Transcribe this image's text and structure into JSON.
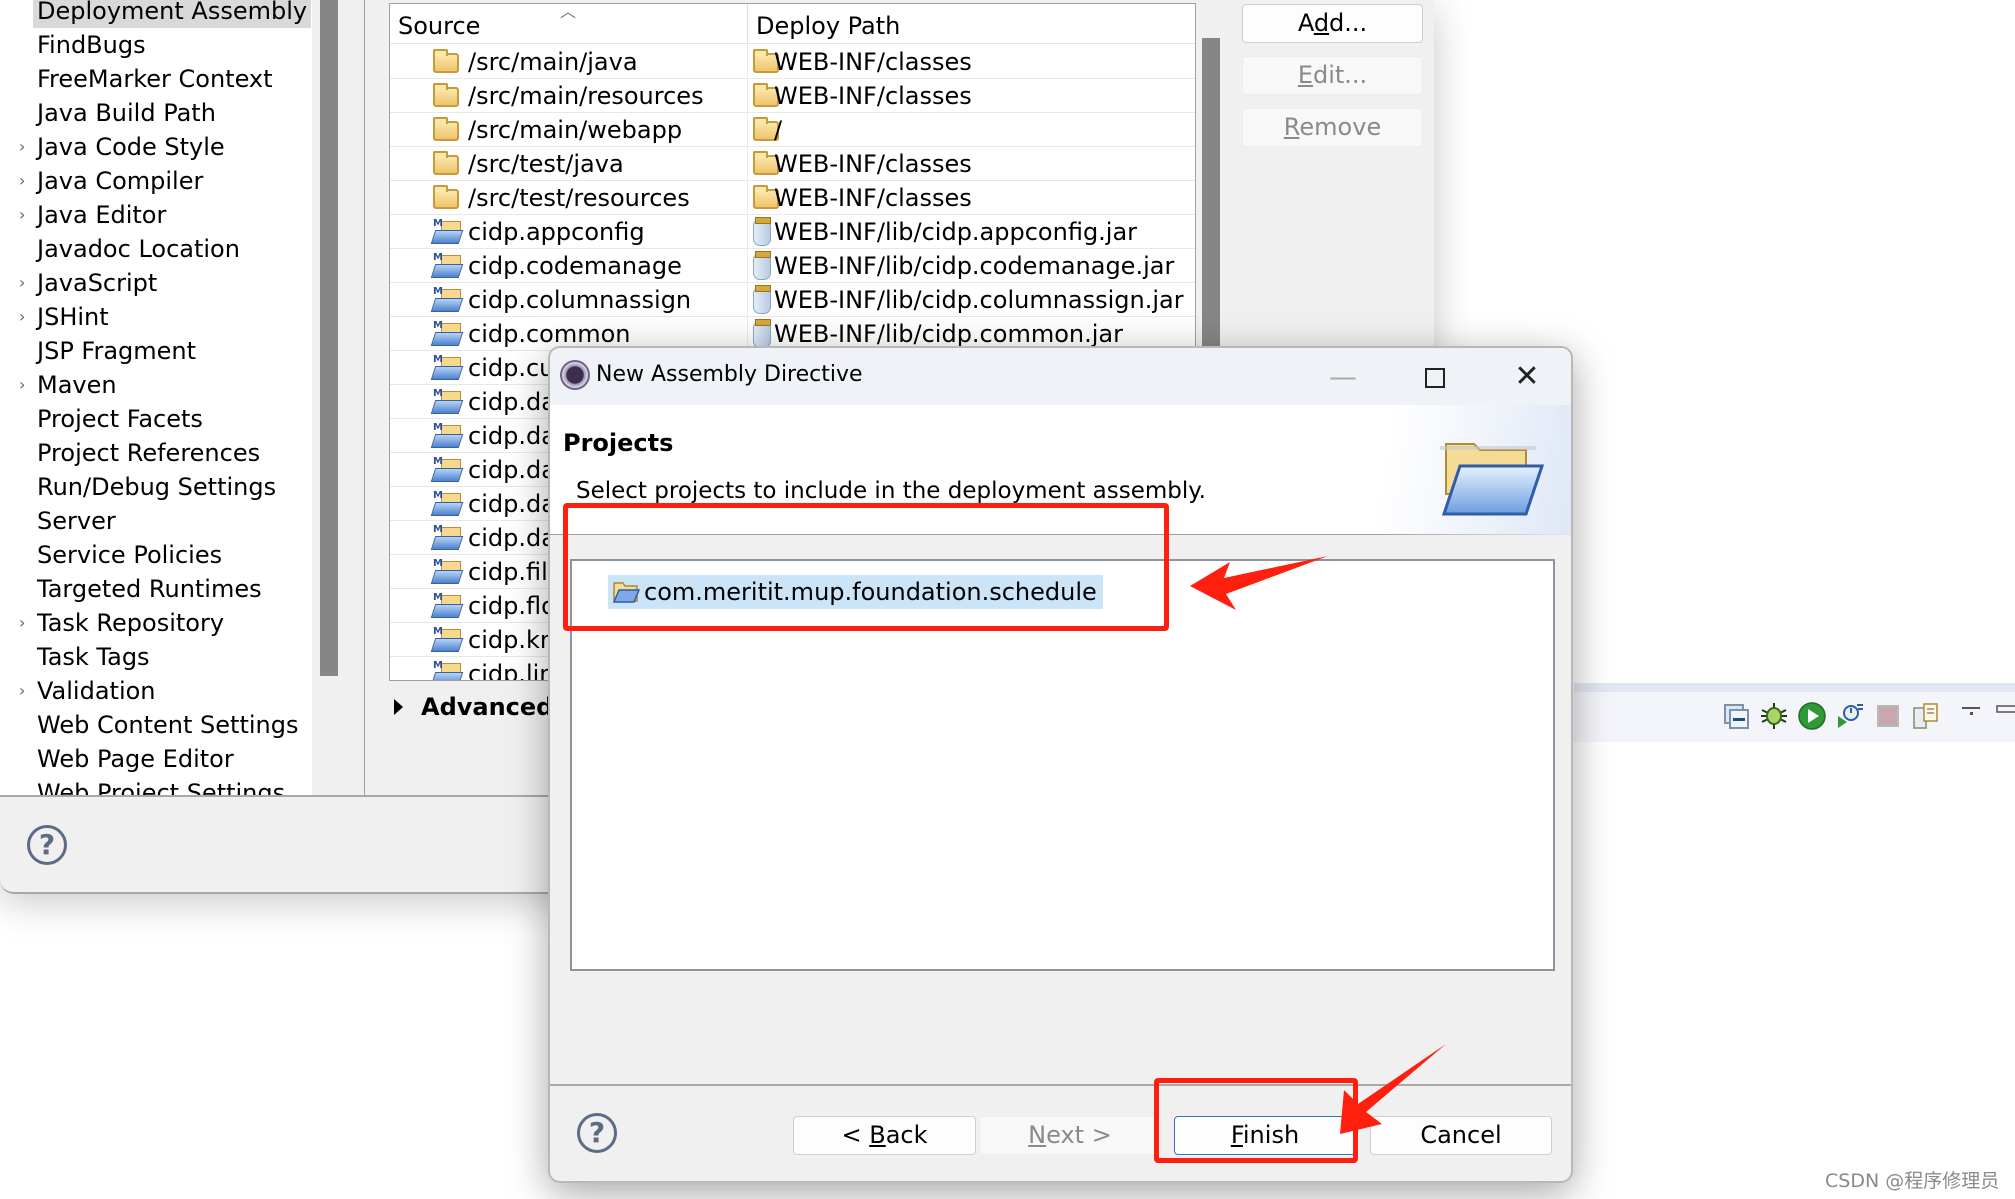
{
  "properties_dialog": {
    "sidebar": {
      "items": [
        {
          "label": "Deployment Assembly",
          "expandable": false,
          "selected": true
        },
        {
          "label": "FindBugs",
          "expandable": false
        },
        {
          "label": "FreeMarker Context",
          "expandable": false
        },
        {
          "label": "Java Build Path",
          "expandable": false
        },
        {
          "label": "Java Code Style",
          "expandable": true
        },
        {
          "label": "Java Compiler",
          "expandable": true
        },
        {
          "label": "Java Editor",
          "expandable": true
        },
        {
          "label": "Javadoc Location",
          "expandable": false
        },
        {
          "label": "JavaScript",
          "expandable": true
        },
        {
          "label": "JSHint",
          "expandable": true
        },
        {
          "label": "JSP Fragment",
          "expandable": false
        },
        {
          "label": "Maven",
          "expandable": true
        },
        {
          "label": "Project Facets",
          "expandable": false
        },
        {
          "label": "Project References",
          "expandable": false
        },
        {
          "label": "Run/Debug Settings",
          "expandable": false
        },
        {
          "label": "Server",
          "expandable": false
        },
        {
          "label": "Service Policies",
          "expandable": false
        },
        {
          "label": "Targeted Runtimes",
          "expandable": false
        },
        {
          "label": "Task Repository",
          "expandable": true
        },
        {
          "label": "Task Tags",
          "expandable": false
        },
        {
          "label": "Validation",
          "expandable": true
        },
        {
          "label": "Web Content Settings",
          "expandable": false
        },
        {
          "label": "Web Page Editor",
          "expandable": false
        },
        {
          "label": "Web Project Settings",
          "expandable": false
        }
      ]
    },
    "table": {
      "columns": [
        "Source",
        "Deploy Path"
      ],
      "sort_indicator": "^",
      "rows": [
        {
          "source": "/src/main/java",
          "source_icon": "folder-icon",
          "deploy": "WEB-INF/classes",
          "deploy_icon": "folder-icon"
        },
        {
          "source": "/src/main/resources",
          "source_icon": "folder-icon",
          "deploy": "WEB-INF/classes",
          "deploy_icon": "folder-icon"
        },
        {
          "source": "/src/main/webapp",
          "source_icon": "folder-icon",
          "deploy": "/",
          "deploy_icon": "folder-icon"
        },
        {
          "source": "/src/test/java",
          "source_icon": "folder-icon",
          "deploy": "WEB-INF/classes",
          "deploy_icon": "folder-icon"
        },
        {
          "source": "/src/test/resources",
          "source_icon": "folder-icon",
          "deploy": "WEB-INF/classes",
          "deploy_icon": "folder-icon"
        },
        {
          "source": "cidp.appconfig",
          "source_icon": "maven-project-icon",
          "deploy": "WEB-INF/lib/cidp.appconfig.jar",
          "deploy_icon": "jar-icon"
        },
        {
          "source": "cidp.codemanage",
          "source_icon": "maven-project-icon",
          "deploy": "WEB-INF/lib/cidp.codemanage.jar",
          "deploy_icon": "jar-icon"
        },
        {
          "source": "cidp.columnassign",
          "source_icon": "maven-project-icon",
          "deploy": "WEB-INF/lib/cidp.columnassign.jar",
          "deploy_icon": "jar-icon"
        },
        {
          "source": "cidp.common",
          "source_icon": "maven-project-icon",
          "deploy": "WEB-INF/lib/cidp.common.jar",
          "deploy_icon": "jar-icon"
        },
        {
          "source": "cidp.cu",
          "source_icon": "maven-project-icon",
          "deploy": "",
          "deploy_icon": ""
        },
        {
          "source": "cidp.da",
          "source_icon": "maven-project-icon",
          "deploy": "",
          "deploy_icon": ""
        },
        {
          "source": "cidp.da",
          "source_icon": "maven-project-icon",
          "deploy": "",
          "deploy_icon": ""
        },
        {
          "source": "cidp.da",
          "source_icon": "maven-project-icon",
          "deploy": "",
          "deploy_icon": ""
        },
        {
          "source": "cidp.da",
          "source_icon": "maven-project-icon",
          "deploy": "",
          "deploy_icon": ""
        },
        {
          "source": "cidp.da",
          "source_icon": "maven-project-icon",
          "deploy": "",
          "deploy_icon": ""
        },
        {
          "source": "cidp.file",
          "source_icon": "maven-project-icon",
          "deploy": "",
          "deploy_icon": ""
        },
        {
          "source": "cidp.flo",
          "source_icon": "maven-project-icon",
          "deploy": "",
          "deploy_icon": ""
        },
        {
          "source": "cidp.kn",
          "source_icon": "maven-project-icon",
          "deploy": "",
          "deploy_icon": ""
        },
        {
          "source": "cidp.lim",
          "source_icon": "maven-project-icon",
          "deploy": "",
          "deploy_icon": ""
        }
      ]
    },
    "buttons": {
      "add": {
        "pre": "A",
        "mnemonic": "d",
        "post": "d...",
        "enabled": true
      },
      "edit": {
        "pre": "",
        "mnemonic": "E",
        "post": "dit...",
        "enabled": false
      },
      "remove": {
        "pre": "",
        "mnemonic": "R",
        "post": "emove",
        "enabled": false
      }
    },
    "advanced_label": "Advanced",
    "help_icon": "help-icon"
  },
  "workbench_toolbar": {
    "icons": [
      "collapse-all-icon",
      "debug-icon",
      "run-icon",
      "profile-icon",
      "stop-icon",
      "copy-icon",
      "view-menu-icon",
      "minimize-icon"
    ]
  },
  "assembly_dialog": {
    "title": "New Assembly Directive",
    "window_controls": {
      "minimize": "—",
      "maximize": "☐",
      "close": "✕"
    },
    "header": {
      "title": "Projects",
      "description": "Select projects to include in the deployment assembly."
    },
    "projects": [
      {
        "name": "com.meritit.mup.foundation.schedule",
        "selected": true
      }
    ],
    "buttons": {
      "back": {
        "pre": "< ",
        "mnemonic": "B",
        "post": "ack",
        "enabled": true
      },
      "next": {
        "pre": "",
        "mnemonic": "N",
        "post": "ext >",
        "enabled": false
      },
      "finish": {
        "pre": "",
        "mnemonic": "F",
        "post": "inish",
        "enabled": true,
        "default": true
      },
      "cancel": {
        "pre": "",
        "mnemonic": "",
        "post": "Cancel",
        "enabled": true
      }
    }
  },
  "annotations": {
    "color": "#fe1f0f",
    "highlight": [
      "project-item",
      "finish-button"
    ]
  },
  "watermark": "CSDN @程序修理员"
}
